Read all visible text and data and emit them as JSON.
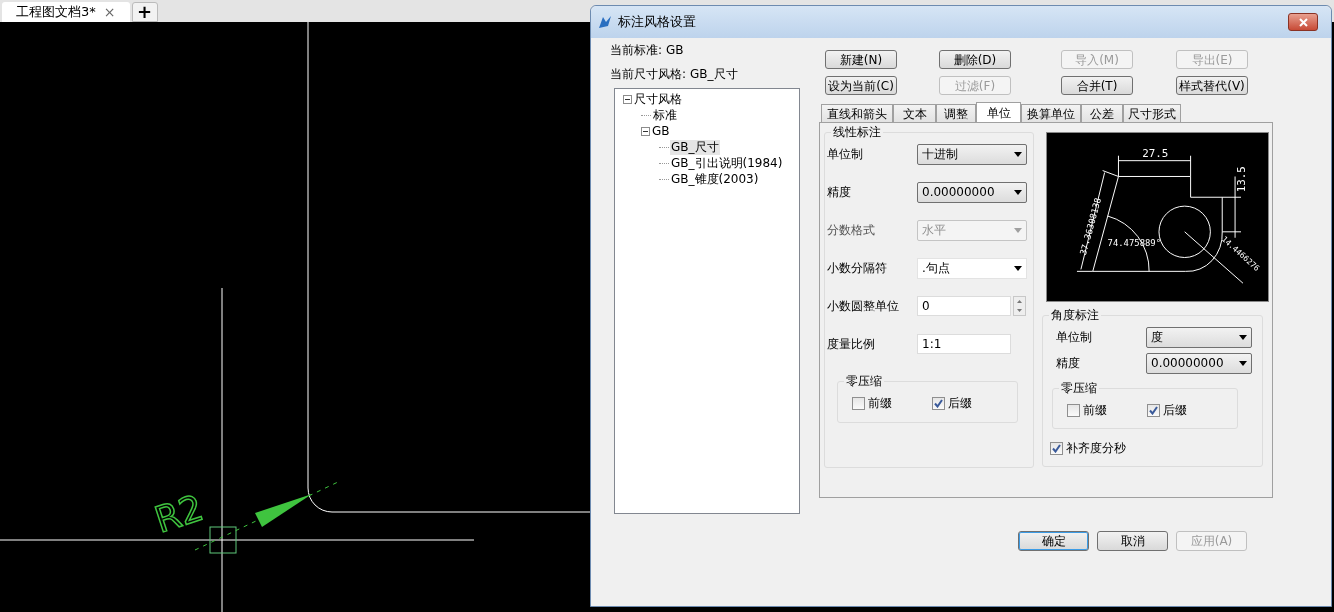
{
  "document_tabs": [
    {
      "label": "工程图文档3*",
      "selected": true,
      "close": "×"
    }
  ],
  "new_tab": "+",
  "canvas": {
    "dimension_text": "R2"
  },
  "dialog": {
    "title": "标注风格设置",
    "current_standard": {
      "label": "当前标准:",
      "value": "GB"
    },
    "current_style": {
      "label": "当前尺寸风格:",
      "value": "GB_尺寸"
    },
    "tree": [
      {
        "label": "尺寸风格",
        "expanded": true,
        "selected": false,
        "children": [
          {
            "label": "标准",
            "selected": false
          },
          {
            "label": "GB",
            "expanded": true,
            "selected": false,
            "children": [
              {
                "label": "GB_尺寸",
                "selected": true
              },
              {
                "label": "GB_引出说明(1984)",
                "selected": false
              },
              {
                "label": "GB_锥度(2003)",
                "selected": false
              }
            ]
          }
        ]
      }
    ],
    "buttons": [
      {
        "label": "新建(N)",
        "disabled": false
      },
      {
        "label": "删除(D)",
        "disabled": false
      },
      {
        "label": "导入(M)",
        "disabled": true
      },
      {
        "label": "导出(E)",
        "disabled": true
      },
      {
        "label": "设为当前(C)",
        "disabled": false
      },
      {
        "label": "过滤(F)",
        "disabled": true
      },
      {
        "label": "合并(T)",
        "disabled": false
      },
      {
        "label": "样式替代(V)",
        "disabled": false
      }
    ],
    "tabs": [
      {
        "label": "直线和箭头",
        "selected": false
      },
      {
        "label": "文本",
        "selected": false
      },
      {
        "label": "调整",
        "selected": false
      },
      {
        "label": "单位",
        "selected": true
      },
      {
        "label": "换算单位",
        "selected": false
      },
      {
        "label": "公差",
        "selected": false
      },
      {
        "label": "尺寸形式",
        "selected": false
      }
    ],
    "linear": {
      "title": "线性标注",
      "fields": [
        {
          "kind": "select",
          "label": "单位制",
          "value": "十进制",
          "disabled": false
        },
        {
          "kind": "select",
          "label": "精度",
          "value": "0.00000000",
          "disabled": false
        },
        {
          "kind": "select",
          "label": "分数格式",
          "value": "水平",
          "disabled": true
        },
        {
          "kind": "combo",
          "label": "小数分隔符",
          "value": ".句点",
          "disabled": false
        },
        {
          "kind": "spin",
          "label": "小数圆整单位",
          "value": "0"
        },
        {
          "kind": "text",
          "label": "度量比例",
          "value": "1:1"
        }
      ],
      "zero_suppression": {
        "title": "零压缩",
        "options": [
          {
            "label": "前缀",
            "checked": false
          },
          {
            "label": "后缀",
            "checked": true
          }
        ]
      }
    },
    "preview": {
      "horizontal_dim": "27.5",
      "vertical_dim": "13.5",
      "aligned_dim": "37.36308138",
      "angle_dim": "74.475889°",
      "diameter_dim": "14.4466276"
    },
    "angular": {
      "title": "角度标注",
      "fields": [
        {
          "kind": "select",
          "label": "单位制",
          "value": "度",
          "disabled": false
        },
        {
          "kind": "select",
          "label": "精度",
          "value": "0.00000000",
          "disabled": false
        }
      ],
      "zero_suppression": {
        "title": "零压缩",
        "options": [
          {
            "label": "前缀",
            "checked": false
          },
          {
            "label": "后缀",
            "checked": true
          }
        ]
      },
      "fill_option": {
        "label": "补齐度分秒",
        "checked": true
      }
    },
    "footer_buttons": [
      {
        "label": "确定",
        "disabled": false,
        "default": true
      },
      {
        "label": "取消",
        "disabled": false,
        "default": false
      },
      {
        "label": "应用(A)",
        "disabled": true,
        "default": false
      }
    ]
  }
}
